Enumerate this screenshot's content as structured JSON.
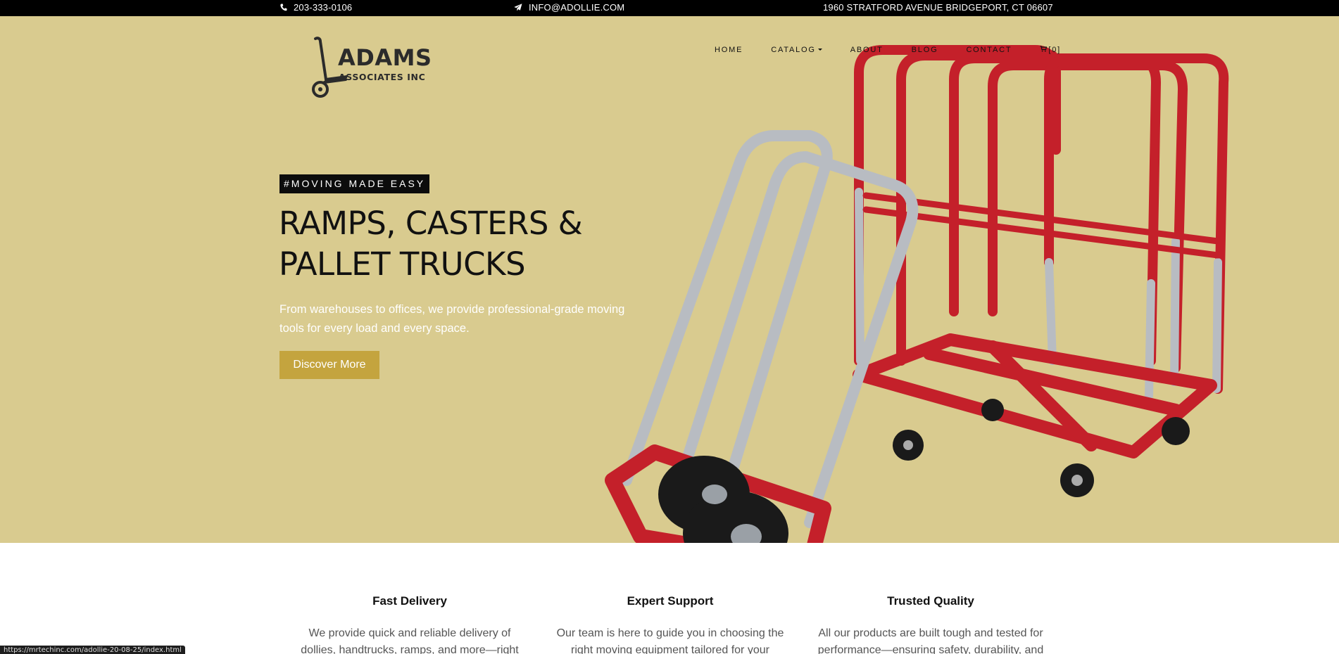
{
  "topbar": {
    "phone": "203-333-0106",
    "email": "INFO@ADOLLIE.COM",
    "address": "1960 STRATFORD AVENUE BRIDGEPORT, CT 06607",
    "icons": {
      "phone": "phone-icon",
      "email": "paper-plane-icon"
    }
  },
  "brand": {
    "line1": "ADAMS",
    "line2": "ASSOCIATES INC",
    "logo_icon": "hand-truck-icon"
  },
  "nav": {
    "home": "HOME",
    "catalog": "CATALOG",
    "about": "ABOUT",
    "blog": "BLOG",
    "contact": "CONTACT",
    "cart": "[0]"
  },
  "hero": {
    "tagline": "#MOVING MADE EASY",
    "headline_line1": "RAMPS, CASTERS &",
    "headline_line2": "PALLET TRUCKS",
    "lead": "From warehouses to offices, we provide professional-grade moving tools for every load and every space.",
    "cta": "Discover More",
    "background_color": "#d9cb8f",
    "accent_color": "#c4a43e"
  },
  "features": [
    {
      "title": "Fast Delivery",
      "text": "We provide quick and reliable delivery of dollies, handtrucks, ramps, and more—right"
    },
    {
      "title": "Expert Support",
      "text": "Our team is here to guide you in choosing the right moving equipment tailored for your"
    },
    {
      "title": "Trusted Quality",
      "text": "All our products are built tough and tested for performance—ensuring safety, durability, and"
    }
  ],
  "status_url": "https://mrtechinc.com/adollie-20-08-25/index.html"
}
